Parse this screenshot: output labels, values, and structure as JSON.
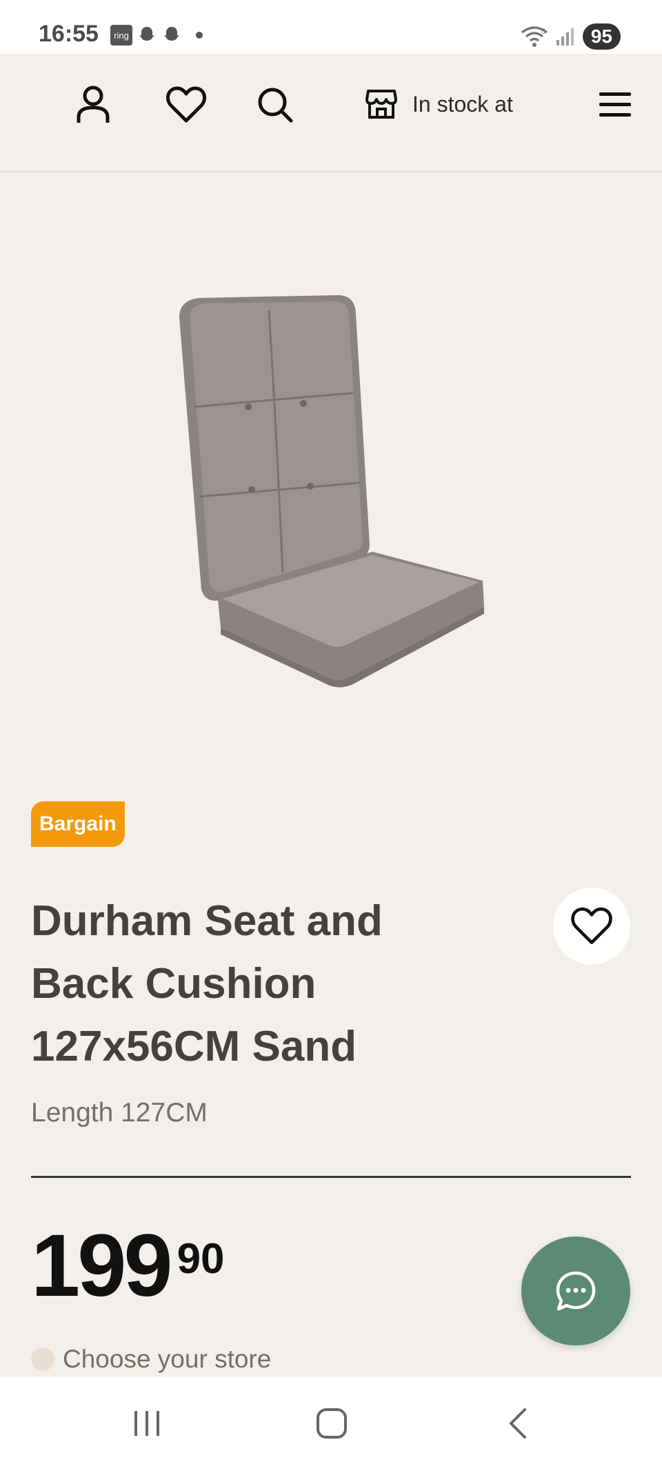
{
  "status_bar": {
    "time": "16:55",
    "ring_label": "ring",
    "battery": "95",
    "wifi_band": "5"
  },
  "header": {
    "account_icon": "user-icon",
    "wishlist_icon": "heart-icon",
    "search_icon": "search-icon",
    "store_icon": "store-icon",
    "store_label": "In stock at",
    "menu_icon": "hamburger-menu-icon"
  },
  "product": {
    "badge": "Bargain",
    "title": "Durham Seat and Back Cushion 127x56CM Sand",
    "variant": "Length 127CM",
    "price_main": "199",
    "price_decimal": "90",
    "store_prompt": "Choose your store"
  },
  "colors": {
    "background": "#f3f0eb",
    "badge": "#f5990c",
    "chat_button": "#5b8a75",
    "divider": "#2f3b2f"
  }
}
